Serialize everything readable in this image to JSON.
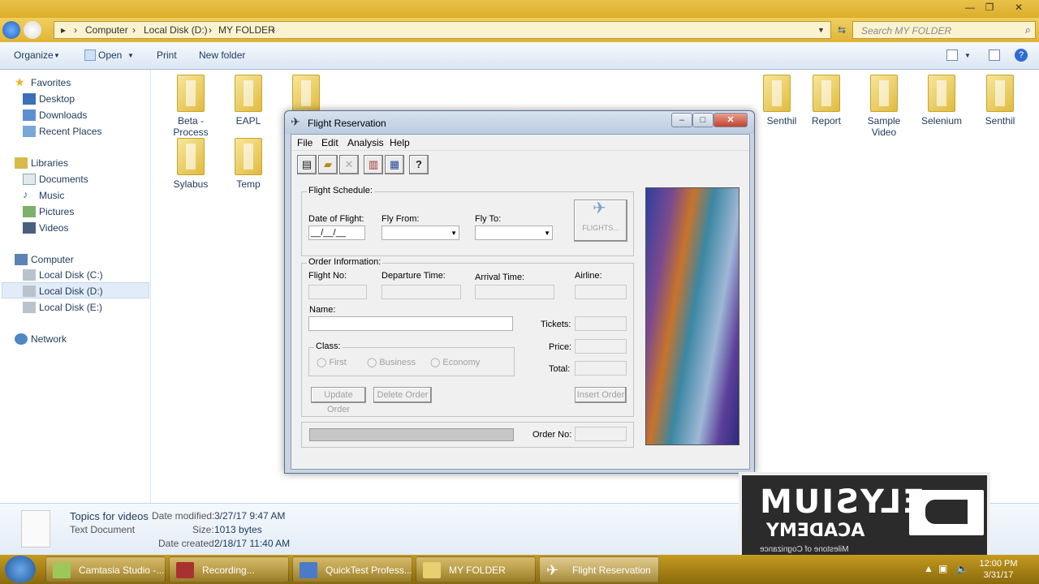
{
  "explorer": {
    "breadcrumbs": [
      "Computer",
      "Local Disk (D:)",
      "MY FOLDER"
    ],
    "search_placeholder": "Search MY FOLDER",
    "commands": [
      "Organize",
      "Open",
      "Print",
      "New folder"
    ],
    "nav": {
      "favorites": "Favorites",
      "desktop": "Desktop",
      "downloads": "Downloads",
      "recent": "Recent Places",
      "libraries": "Libraries",
      "documents": "Documents",
      "music": "Music",
      "pictures": "Pictures",
      "videos": "Videos",
      "computer": "Computer",
      "disk_c": "Local Disk (C:)",
      "disk_d": "Local Disk (D:)",
      "disk_e": "Local Disk (E:)",
      "network": "Network"
    },
    "folders": {
      "beta": "Beta - Process",
      "eapl": "EAPL",
      "senthil1": "Senthil",
      "report": "Report",
      "sample": "Sample Video",
      "selenium": "Selenium",
      "senthil2": "Senthil",
      "sylabus": "Sylabus",
      "temp": "Temp"
    },
    "details": {
      "name": "Topics for videos",
      "type": "Text Document",
      "modified_label": "Date modified:",
      "modified": "3/27/17 9:47 AM",
      "size_label": "Size:",
      "size": "1013 bytes",
      "created_label": "Date created:",
      "created": "2/18/17 11:40 AM"
    }
  },
  "flight_window": {
    "title": "Flight Reservation",
    "menu": [
      "File",
      "Edit",
      "Analysis",
      "Help"
    ],
    "schedule": {
      "group": "Flight Schedule:",
      "date_label": "Date of Flight:",
      "date_value": "__/__/__",
      "from_label": "Fly From:",
      "to_label": "Fly To:",
      "flights_button": "FLIGHTS..."
    },
    "order": {
      "group": "Order Information:",
      "flight_no": "Flight No:",
      "departure": "Departure Time:",
      "arrival": "Arrival Time:",
      "airline": "Airline:",
      "name": "Name:",
      "tickets": "Tickets:",
      "price": "Price:",
      "total": "Total:",
      "class_group": "Class:",
      "first": "First",
      "business": "Business",
      "economy": "Economy",
      "update": "Update Order",
      "delete": "Delete Order",
      "insert": "Insert Order",
      "order_no": "Order No:"
    }
  },
  "taskbar": {
    "items": [
      "Camtasia Studio -...",
      "Recording...",
      "QuickTest Profess...",
      "MY FOLDER",
      "Flight Reservation"
    ],
    "time": "12:00 PM",
    "date": "3/31/17"
  },
  "watermark": {
    "line1": "ELYSIUM",
    "line2": "ACADEMY",
    "line3": "Milestone of Cognizance"
  }
}
